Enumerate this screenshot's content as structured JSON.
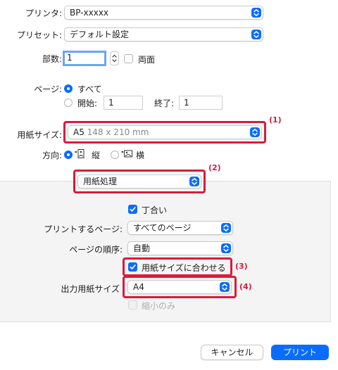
{
  "printer": {
    "label": "プリンタ:",
    "value": "BP-xxxxx"
  },
  "preset": {
    "label": "プリセット:",
    "value": "デフォルト設定"
  },
  "copies": {
    "label": "部数:",
    "value": "1",
    "duplex_label": "両面"
  },
  "pages": {
    "label": "ページ:",
    "all_label": "すべて",
    "from_label": "開始:",
    "from_value": "1",
    "to_label": "終了:",
    "to_value": "1"
  },
  "paper_size": {
    "label": "用紙サイズ:",
    "value": "A5",
    "dims": "148 x 210 mm"
  },
  "orientation": {
    "label": "方向:",
    "portrait": "縦",
    "landscape": "横"
  },
  "section_popup": {
    "value": "用紙処理"
  },
  "paper_handling": {
    "collate_label": "丁合い",
    "pages_to_print_label": "プリントするページ:",
    "pages_to_print_value": "すべてのページ",
    "page_order_label": "ページの順序:",
    "page_order_value": "自動",
    "scale_to_fit_label": "用紙サイズに合わせる",
    "dest_paper_label": "出力用紙サイズ",
    "dest_paper_value": "A4",
    "scale_down_only_label": "縮小のみ"
  },
  "annotations": {
    "a1": "(1)",
    "a2": "(2)",
    "a3": "(3)",
    "a4": "(4)"
  },
  "buttons": {
    "cancel": "キャンセル",
    "print": "プリント"
  },
  "colors": {
    "accent": "#0a6cff",
    "highlight": "#d91b3a"
  }
}
